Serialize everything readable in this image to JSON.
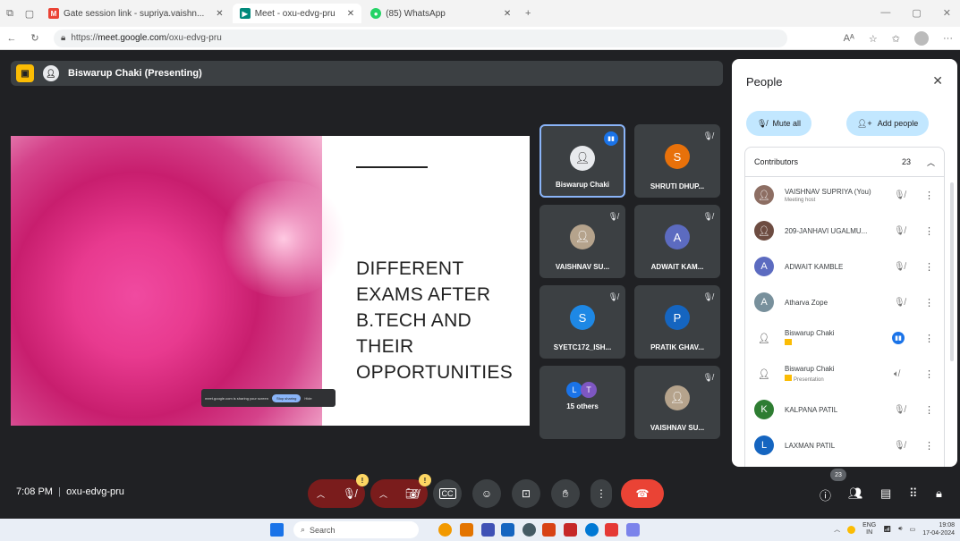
{
  "browser": {
    "tabs": [
      {
        "label": "Gate session link - supriya.vaishn...",
        "icon": "gmail-icon",
        "color": "#ea4335",
        "active": false
      },
      {
        "label": "Meet - oxu-edvg-pru",
        "icon": "meet-icon",
        "color": "#00897b",
        "active": true
      },
      {
        "label": "(85) WhatsApp",
        "icon": "whatsapp-icon",
        "color": "#25d366",
        "active": false
      }
    ],
    "url_prefix": "https://",
    "url_host": "meet.google.com",
    "url_path": "/oxu-edvg-pru"
  },
  "meet": {
    "presenter_label": "Biswarup Chaki (Presenting)",
    "slide_title_lines": [
      "DIFFERENT",
      "EXAMS AFTER",
      "B.TECH AND",
      "THEIR",
      "OPPORTUNITIES"
    ],
    "share_text": "meet.google.com is sharing your screen",
    "share_stop": "Stop sharing",
    "share_hide": "Hide",
    "tiles": [
      {
        "name": "Biswarup Chaki",
        "initial": "",
        "color": "#e8eaed",
        "speaking": true
      },
      {
        "name": "SHRUTI DHUP...",
        "initial": "S",
        "color": "#e8710a",
        "speaking": false
      },
      {
        "name": "VAISHNAV SU...",
        "initial": "",
        "color": "#b5a38c",
        "speaking": false
      },
      {
        "name": "ADWAIT KAM...",
        "initial": "A",
        "color": "#5c6bc0",
        "speaking": false
      },
      {
        "name": "SYETC172_ISH...",
        "initial": "S",
        "color": "#1e88e5",
        "speaking": false
      },
      {
        "name": "PRATIK GHAV...",
        "initial": "P",
        "color": "#1565c0",
        "speaking": false
      },
      {
        "name": "15 others",
        "initial": "",
        "color": "#3c4043",
        "speaking": false
      },
      {
        "name": "VAISHNAV SU...",
        "initial": "",
        "color": "#b5a38c",
        "speaking": false
      }
    ],
    "others_initials": [
      "L",
      "T"
    ],
    "time": "7:08 PM",
    "separator": "|",
    "meeting_code": "oxu-edvg-pru",
    "participant_count": "23"
  },
  "people": {
    "title": "People",
    "mute_all": "Mute all",
    "add_people": "Add people",
    "section": "Contributors",
    "count": "23",
    "list": [
      {
        "name": "VAISHNAV SUPRIYA (You)",
        "sub": "Meeting host",
        "initial": "",
        "color": "#8d6e63",
        "speaking": false
      },
      {
        "name": "209-JANHAVI UGALMU...",
        "sub": "",
        "initial": "",
        "color": "#6d4c41",
        "speaking": false
      },
      {
        "name": "ADWAIT KAMBLE",
        "sub": "",
        "initial": "A",
        "color": "#5c6bc0",
        "speaking": false
      },
      {
        "name": "Atharva Zope",
        "sub": "",
        "initial": "A",
        "color": "#78909c",
        "speaking": false
      },
      {
        "name": "Biswarup Chaki",
        "sub": "",
        "initial": "",
        "color": "#ffffff",
        "speaking": true
      },
      {
        "name": "Biswarup Chaki",
        "sub": "Presentation",
        "initial": "",
        "color": "#ffffff",
        "speaking": false
      },
      {
        "name": "KALPANA PATIL",
        "sub": "",
        "initial": "K",
        "color": "#2e7d32",
        "speaking": false
      },
      {
        "name": "LAXMAN PATIL",
        "sub": "",
        "initial": "L",
        "color": "#1565c0",
        "speaking": false
      }
    ]
  },
  "taskbar": {
    "search_placeholder": "Search",
    "lang": "ENG",
    "region": "IN",
    "clock_time": "19:08",
    "clock_date": "17-04-2024"
  }
}
